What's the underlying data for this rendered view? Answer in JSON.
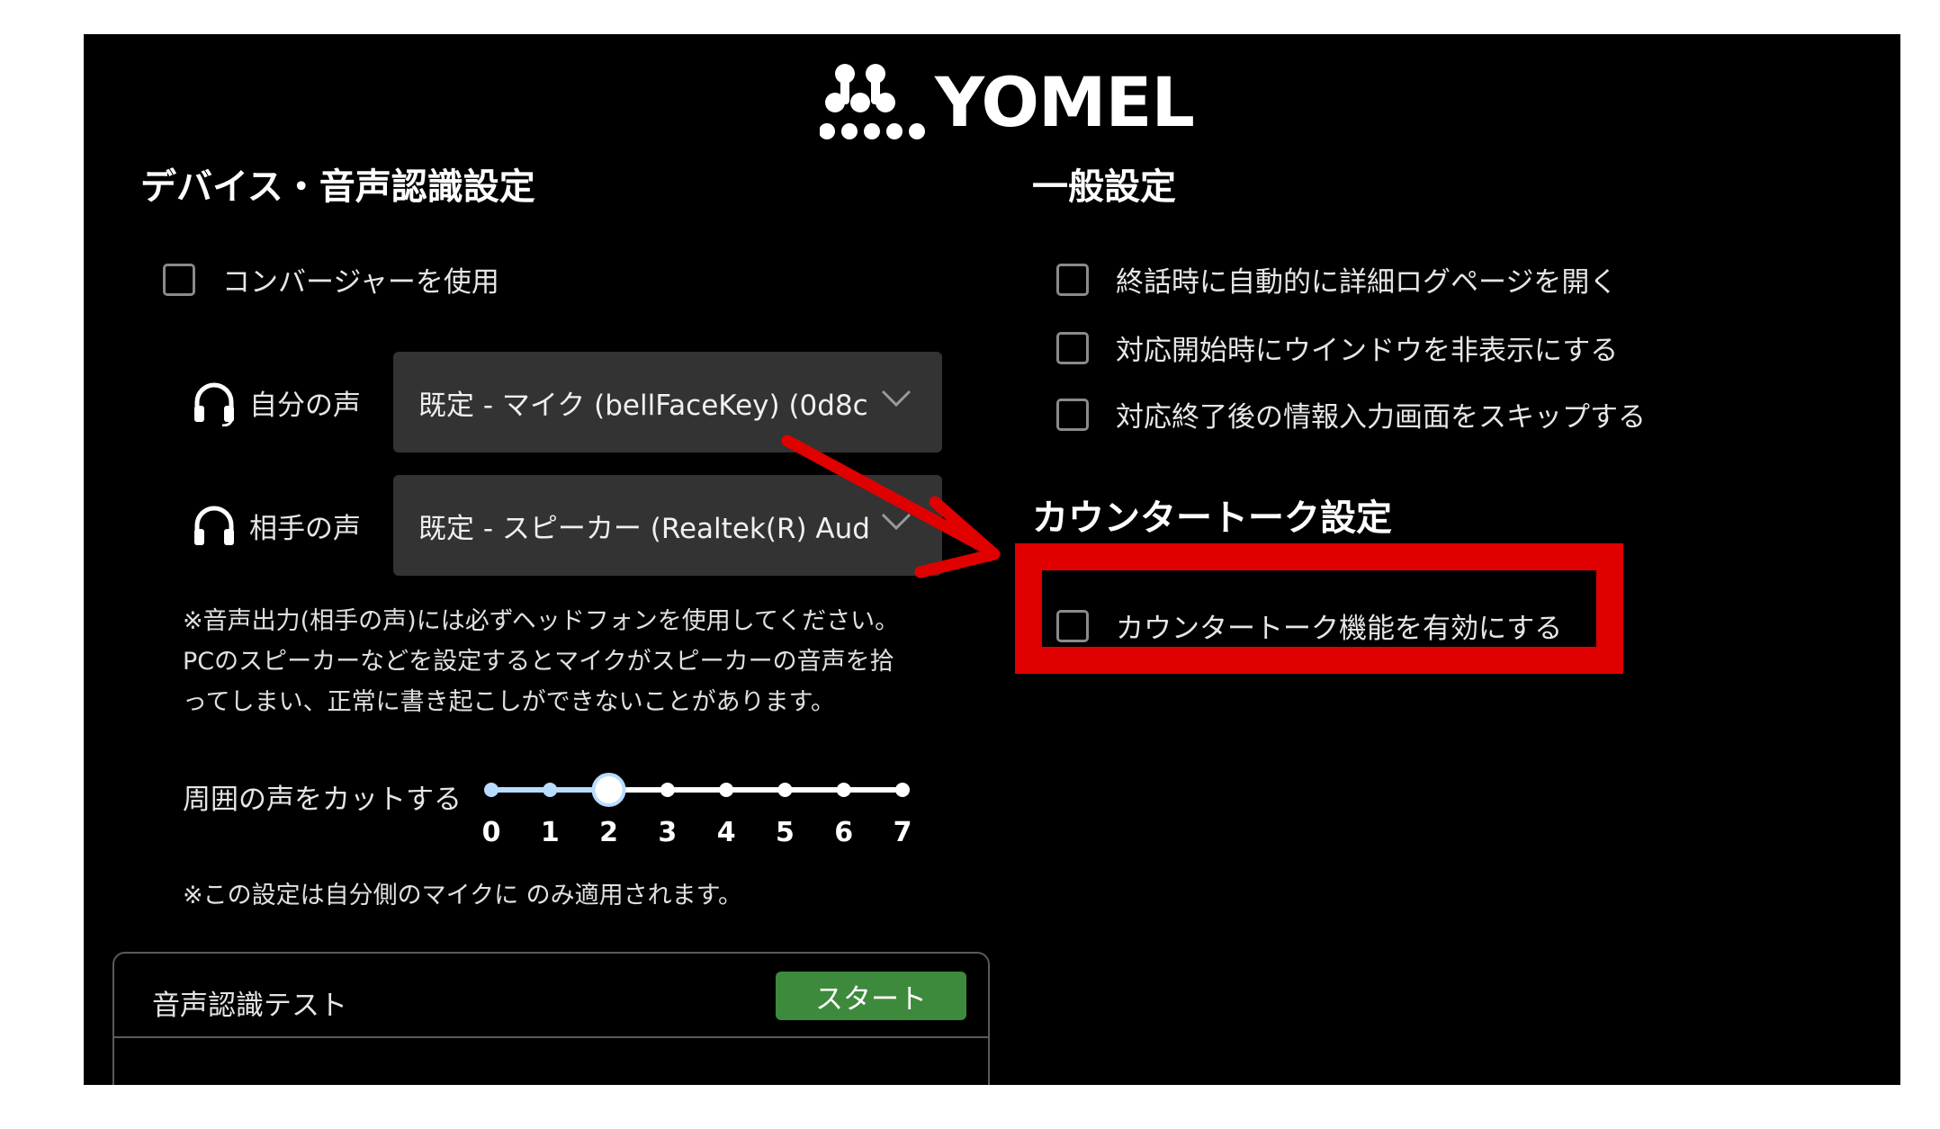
{
  "brand": {
    "name": "YOMEL"
  },
  "device_settings": {
    "title": "デバイス・音声認識設定",
    "converter_label": "コンバージャーを使用",
    "converter_checked": false,
    "my_voice_label": "自分の声",
    "my_voice_value": "既定 - マイク (bellFaceKey) (0d8c",
    "other_voice_label": "相手の声",
    "other_voice_value": "既定 - スピーカー (Realtek(R) Aud",
    "note_lines": [
      "※音声出力(相手の声)には必ずヘッドフォンを使用してください。",
      "PCのスピーカーなどを設定するとマイクがスピーカーの音声を拾",
      "ってしまい、正常に書き起こしができないことがあります。"
    ],
    "noise_cut_label": "周囲の声をカットする",
    "noise_cut_ticks": [
      "0",
      "1",
      "2",
      "3",
      "4",
      "5",
      "6",
      "7"
    ],
    "noise_cut_value": 2,
    "noise_note": "※この設定は自分側のマイクに のみ適用されます。",
    "test_title": "音声認識テスト",
    "start_label": "スタート"
  },
  "general_settings": {
    "title": "一般設定",
    "options": [
      {
        "label": "終話時に自動的に詳細ログページを開く",
        "checked": false
      },
      {
        "label": "対応開始時にウインドウを非表示にする",
        "checked": false
      },
      {
        "label": "対応終了後の情報入力画面をスキップする",
        "checked": false
      }
    ]
  },
  "counter_talk": {
    "title": "カウンタートーク設定",
    "option_label": "カウンタートーク機能を有効にする",
    "checked": false
  },
  "annotation": {
    "highlight_color": "#e10000"
  },
  "colors": {
    "background": "#000000",
    "select_bg": "#333333",
    "start_button": "#3d8a3d",
    "slider": "#b8dcff"
  }
}
